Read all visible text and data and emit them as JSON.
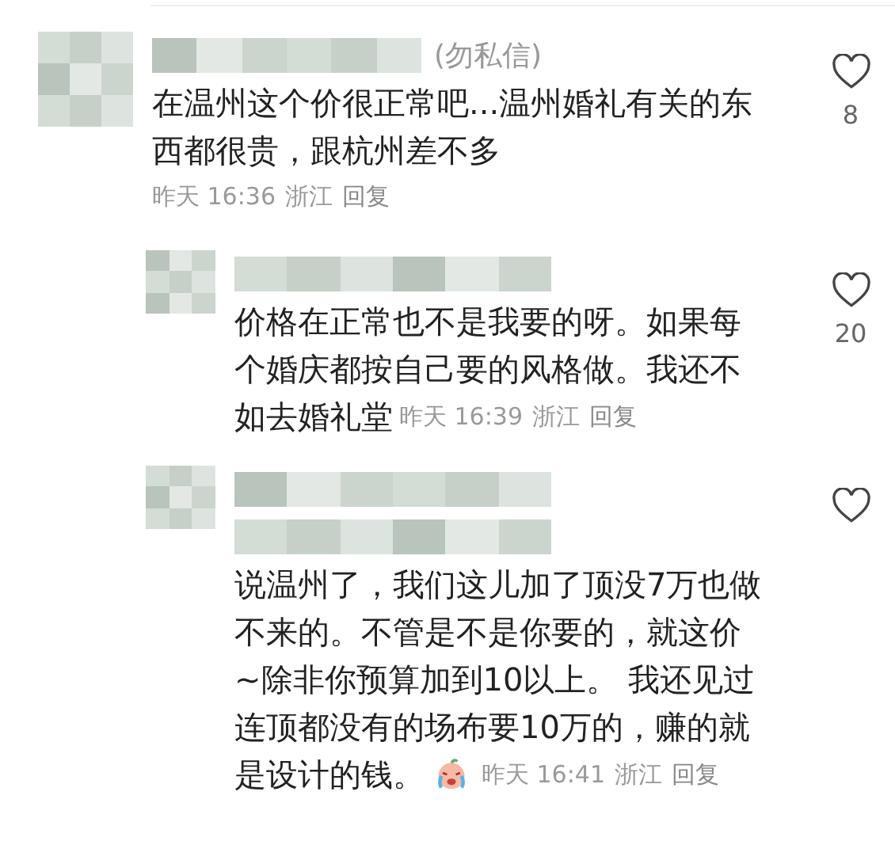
{
  "comments": [
    {
      "kind": "comment",
      "name_suffix": "(勿私信)",
      "lines": [
        "在温州这个价很正常吧...温州婚礼有关的东",
        "西都很贵，跟杭州差不多"
      ],
      "emoji": false,
      "meta_inline": false,
      "time": "昨天 16:36",
      "location": "浙江",
      "reply": "回复",
      "likes": "8"
    },
    {
      "kind": "reply",
      "lines": [
        "价格在正常也不是我要的呀。如果每",
        "个婚庆都按自己要的风格做。我还不",
        "如去婚礼堂"
      ],
      "emoji": false,
      "meta_inline": true,
      "time": "昨天 16:39",
      "location": "浙江",
      "reply": "回复",
      "likes": "20"
    },
    {
      "kind": "reply_tall",
      "lines": [
        "说温州了，我们这儿加了顶没7万也做",
        "不来的。不管是不是你要的，就这价",
        "~除非你预算加到10以上。 我还见过",
        "连顶都没有的场布要10万的，赚的就",
        "是设计的钱。"
      ],
      "emoji": true,
      "meta_inline": true,
      "time": "昨天 16:41",
      "location": "浙江",
      "reply": "回复"
    }
  ]
}
